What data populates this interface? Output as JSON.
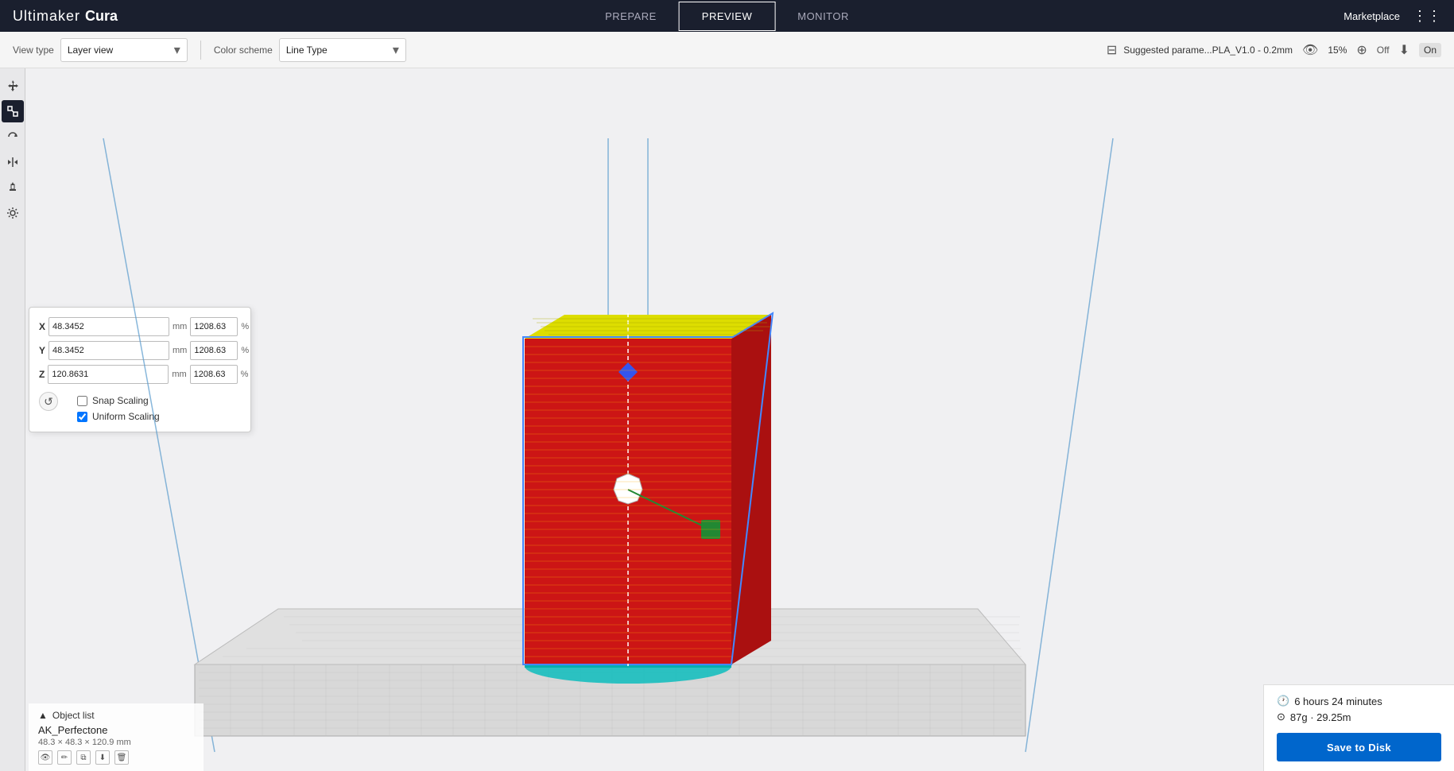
{
  "app": {
    "name_part1": "Ultimaker",
    "name_part2": "Cura"
  },
  "nav": {
    "tabs": [
      {
        "id": "prepare",
        "label": "PREPARE",
        "active": false
      },
      {
        "id": "preview",
        "label": "PREVIEW",
        "active": true
      },
      {
        "id": "monitor",
        "label": "MONITOR",
        "active": false
      }
    ],
    "marketplace_label": "Marketplace",
    "apps_icon": "⋮⋮"
  },
  "toolbar": {
    "view_type_label": "View type",
    "view_type_value": "Layer view",
    "color_scheme_label": "Color scheme",
    "color_scheme_value": "Line Type",
    "suggested_label": "Suggested parame...PLA_V1.0 - 0.2mm",
    "percent": "15%",
    "off_label": "Off",
    "on_label": "On"
  },
  "scale_panel": {
    "x_label": "X",
    "x_mm_value": "48.3452",
    "x_mm_unit": "mm",
    "x_pct_value": "1208.63",
    "x_pct_unit": "%",
    "y_label": "Y",
    "y_mm_value": "48.3452",
    "y_mm_unit": "mm",
    "y_pct_value": "1208.63",
    "y_pct_unit": "%",
    "z_label": "Z",
    "z_mm_value": "120.8631",
    "z_mm_unit": "mm",
    "z_pct_value": "1208.63",
    "z_pct_unit": "%",
    "snap_scaling_label": "Snap Scaling",
    "snap_scaling_checked": false,
    "uniform_scaling_label": "Uniform Scaling",
    "uniform_scaling_checked": true,
    "reset_icon": "↺"
  },
  "object_list": {
    "header_label": "Object list",
    "collapse_icon": "▲",
    "edit_icon": "✏",
    "object_name": "AK_Perfectone",
    "dimensions": "48.3 × 48.3 × 120.9 mm"
  },
  "print_info": {
    "time_icon": "🕐",
    "time_label": "6 hours 24 minutes",
    "weight_icon": "◎",
    "weight_label": "87g · 29.25m",
    "save_label": "Save to Disk"
  },
  "colors": {
    "accent_blue": "#1a6dbf",
    "titlebar_bg": "#1a1f2e",
    "active_tab_border": "#ffffff",
    "toolbar_bg": "#f5f5f5",
    "object_red": "#cc1111",
    "object_yellow": "#dddd00",
    "object_cyan": "#00cccc",
    "handle_blue": "#3355ee",
    "handle_green": "#228833",
    "handle_white": "#ffffff"
  }
}
